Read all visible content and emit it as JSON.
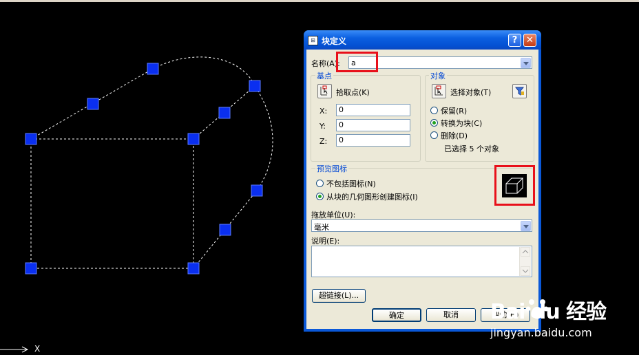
{
  "canvas": {
    "axis_label": "X"
  },
  "dialog": {
    "title": "块定义",
    "help": "?",
    "close": "✕",
    "name_label": "名称(A):",
    "name_value": "a",
    "basepoint": {
      "group_label": "基点",
      "pick_label": "拾取点(K)",
      "x_label": "X:",
      "x_value": "0",
      "y_label": "Y:",
      "y_value": "0",
      "z_label": "Z:",
      "z_value": "0"
    },
    "objects": {
      "group_label": "对象",
      "select_label": "选择对象(T)",
      "retain_label": "保留(R)",
      "convert_label": "转换为块(C)",
      "delete_label": "删除(D)",
      "status_text": "已选择 5 个对象"
    },
    "preview": {
      "group_label": "预览图标",
      "no_icon_label": "不包括图标(N)",
      "create_icon_label": "从块的几何图形创建图标(I)"
    },
    "units_label": "拖放单位(U):",
    "units_value": "毫米",
    "description_label": "说明(E):",
    "hyperlink_button": "超链接(L)...",
    "ok_button": "确定",
    "cancel_button": "取消",
    "help_button": "帮助(H)"
  },
  "watermark": {
    "brand": "Bai du 经验",
    "url": "jingyan.baidu.com"
  },
  "colors": {
    "grip": "#0a2ff0",
    "highlight": "#e8101a",
    "titlebar": "#0451d3"
  }
}
